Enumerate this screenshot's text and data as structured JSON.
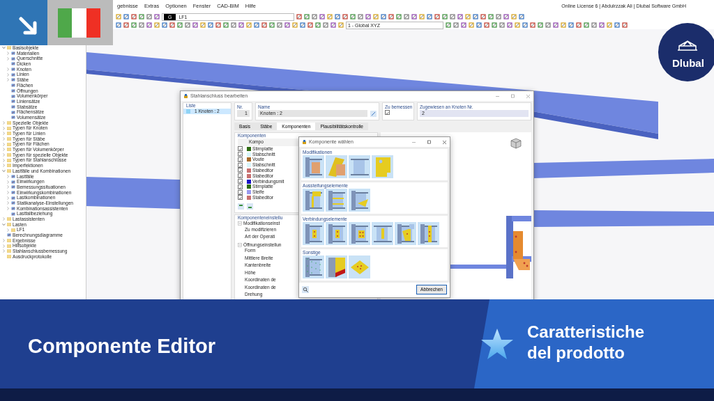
{
  "menu": [
    "gebnisse",
    "Extras",
    "Optionen",
    "Fenster",
    "CAD-BIM",
    "Hilfe"
  ],
  "license": "Online License 6 | Abdulrzzak Ali | Dlubal Software GmbH",
  "toolbar": {
    "load_case_code": "G",
    "load_case": "LF1",
    "view": "1 - Global XYZ"
  },
  "navigator": [
    {
      "label": "Basisobjekte",
      "kind": "folder",
      "expanded": true,
      "children": [
        {
          "label": "Materialien",
          "kind": "item",
          "expanded": false
        },
        {
          "label": "Querschnitte",
          "kind": "item",
          "expanded": false
        },
        {
          "label": "Dicken",
          "kind": "item"
        },
        {
          "label": "Knoten",
          "kind": "item",
          "expanded": false
        },
        {
          "label": "Linien",
          "kind": "item",
          "expanded": false
        },
        {
          "label": "Stäbe",
          "kind": "item",
          "expanded": false
        },
        {
          "label": "Flächen",
          "kind": "item"
        },
        {
          "label": "Öffnungen",
          "kind": "item"
        },
        {
          "label": "Volumenkörper",
          "kind": "item"
        },
        {
          "label": "Liniensätze",
          "kind": "item"
        },
        {
          "label": "Stabsätze",
          "kind": "item"
        },
        {
          "label": "Flächensätze",
          "kind": "item"
        },
        {
          "label": "Volumensätze",
          "kind": "item"
        }
      ]
    },
    {
      "label": "Spezielle Objekte",
      "kind": "folder",
      "expanded": false
    },
    {
      "label": "Typen für Knoten",
      "kind": "folder",
      "expanded": false
    },
    {
      "label": "Typen für Linien",
      "kind": "folder",
      "expanded": false
    },
    {
      "label": "Typen für Stäbe",
      "kind": "folder",
      "expanded": false
    },
    {
      "label": "Typen für Flächen",
      "kind": "folder",
      "expanded": false
    },
    {
      "label": "Typen für Volumenkörper",
      "kind": "folder",
      "expanded": false
    },
    {
      "label": "Typen für spezielle Objekte",
      "kind": "folder",
      "expanded": false
    },
    {
      "label": "Typen für Stahlanschlüsse",
      "kind": "folder",
      "expanded": false
    },
    {
      "label": "Imperfektionen",
      "kind": "folder",
      "expanded": false
    },
    {
      "label": "Lastfälle und Kombinationen",
      "kind": "folder",
      "expanded": true,
      "children": [
        {
          "label": "Lastfälle",
          "kind": "item",
          "expanded": false
        },
        {
          "label": "Einwirkungen",
          "kind": "item",
          "expanded": false
        },
        {
          "label": "Bemessungssituationen",
          "kind": "item",
          "expanded": false
        },
        {
          "label": "Einwirkungskombinationen",
          "kind": "item",
          "expanded": false
        },
        {
          "label": "Lastkombinationen",
          "kind": "item",
          "expanded": false
        },
        {
          "label": "Statikanalyse-Einstellungen",
          "kind": "item",
          "expanded": false
        },
        {
          "label": "Kombinationsassistenten",
          "kind": "item",
          "expanded": false
        },
        {
          "label": "Lastfallbeziehung",
          "kind": "item"
        }
      ]
    },
    {
      "label": "Lastassistenten",
      "kind": "folder",
      "expanded": false
    },
    {
      "label": "Lasten",
      "kind": "folder",
      "expanded": true,
      "children": [
        {
          "label": "LF1",
          "kind": "folder",
          "expanded": false
        }
      ]
    },
    {
      "label": "Berechnungsdiagramme",
      "kind": "item"
    },
    {
      "label": "Ergebnisse",
      "kind": "folder",
      "expanded": false
    },
    {
      "label": "Hilfsobjekte",
      "kind": "folder",
      "expanded": false
    },
    {
      "label": "Stahlanschlussbemessung",
      "kind": "folder",
      "expanded": false
    },
    {
      "label": "Ausdruckprotokolle",
      "kind": "folder"
    }
  ],
  "editor": {
    "title": "Stahlanschluss bearbeiten",
    "list_label": "Liste",
    "list_items": [
      {
        "number": "1",
        "label": "Knoten : 2",
        "selected": true
      }
    ],
    "nr_label": "Nr.",
    "nr": "1",
    "name_label": "Name",
    "name": "Knoten : 2",
    "design_label": "Zu bemessen",
    "design_checked": true,
    "assign_label": "Zugewiesen an Knoten Nr.",
    "assign": "2",
    "tabs": [
      {
        "label": "Basis",
        "selected": false
      },
      {
        "label": "Stäbe",
        "selected": false
      },
      {
        "label": "Komponenten",
        "selected": true
      },
      {
        "label": "Plausibilitätskontrolle",
        "selected": false
      }
    ],
    "components_title": "Komponenten",
    "column_1": "Kompo",
    "components": [
      {
        "name": "Stirnplatte",
        "color": "#2e6b12",
        "checked": true
      },
      {
        "name": "Stabschnitt",
        "color": "#d8f6fb",
        "checked": true
      },
      {
        "name": "Voute",
        "color": "#a86a2a",
        "checked": true
      },
      {
        "name": "Stabschnitt",
        "color": "#d8f6fb",
        "checked": true
      },
      {
        "name": "Stabeditor",
        "color": "#c87070",
        "checked": true
      },
      {
        "name": "Stabeditor",
        "color": "#c87070",
        "checked": true
      },
      {
        "name": "Verbindungsmit",
        "color": "#1a14c8",
        "checked": true
      },
      {
        "name": "Stirnplatte",
        "color": "#2e6b12",
        "checked": true
      },
      {
        "name": "Steife",
        "color": "#9a9af0",
        "checked": true
      },
      {
        "name": "Stabeditor",
        "color": "#c87070",
        "checked": true
      }
    ],
    "settings_title": "Komponenteneinstellu",
    "settings": [
      {
        "label": "Modifikationseinst",
        "expanded": true,
        "children": [
          {
            "label": "Zu modifizieren"
          },
          {
            "label": "Art der Operati"
          }
        ]
      },
      {
        "label": "Öffnungseinstellun",
        "expanded": true,
        "children": [
          {
            "label": "Form"
          },
          {
            "label": "Mittlere Breite"
          },
          {
            "label": "Kantenbreite"
          },
          {
            "label": "Höhe"
          },
          {
            "label": "Koordinaten de"
          },
          {
            "label": "Koordinaten de"
          },
          {
            "label": "Drehung"
          }
        ]
      }
    ]
  },
  "picker": {
    "title": "Komponente wählen",
    "cancel": "Abbrechen",
    "sections": [
      {
        "title": "Modifikationen",
        "tiles": [
          {
            "kind": "cut"
          },
          {
            "kind": "skew"
          },
          {
            "kind": "notch"
          },
          {
            "kind": "plate"
          }
        ]
      },
      {
        "title": "Aussteifungselemente",
        "tiles": [
          {
            "kind": "stiffener"
          },
          {
            "kind": "stiffeners"
          },
          {
            "kind": "haunch"
          }
        ]
      },
      {
        "title": "Verbindungselemente",
        "tiles": [
          {
            "kind": "fin"
          },
          {
            "kind": "fin"
          },
          {
            "kind": "bolts"
          },
          {
            "kind": "clip"
          },
          {
            "kind": "gusset"
          },
          {
            "kind": "angle"
          }
        ]
      },
      {
        "title": "Sonstige",
        "tiles": [
          {
            "kind": "grid"
          },
          {
            "kind": "weld"
          },
          {
            "kind": "base"
          }
        ]
      }
    ]
  },
  "logo": {
    "text": "Dlubal"
  },
  "banner": {
    "title": "Componente Editor",
    "subtitle": "Caratteristiche del prodotto"
  }
}
